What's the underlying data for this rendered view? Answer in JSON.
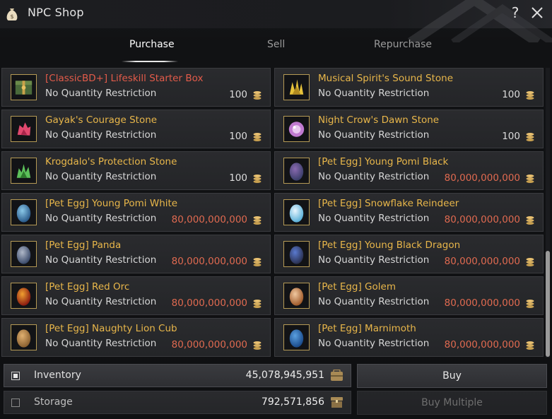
{
  "window": {
    "title": "NPC Shop"
  },
  "titlebar": {
    "help_glyph": "?"
  },
  "tabs": [
    {
      "label": "Purchase",
      "active": true
    },
    {
      "label": "Sell",
      "active": false
    },
    {
      "label": "Repurchase",
      "active": false
    }
  ],
  "items": [
    {
      "name": "[ClassicBD+] Lifeskill Starter Box",
      "restriction": "No Quantity Restriction",
      "price": "100",
      "name_color": "red",
      "icon": "starter-box-icon"
    },
    {
      "name": "Musical Spirit's Sound Stone",
      "restriction": "No Quantity Restriction",
      "price": "100",
      "name_color": "gold",
      "icon": "sound-stone-icon"
    },
    {
      "name": "Gayak's Courage Stone",
      "restriction": "No Quantity Restriction",
      "price": "100",
      "name_color": "gold",
      "icon": "courage-stone-icon"
    },
    {
      "name": "Night Crow's Dawn Stone",
      "restriction": "No Quantity Restriction",
      "price": "100",
      "name_color": "gold",
      "icon": "dawn-stone-icon"
    },
    {
      "name": "Krogdalo's Protection Stone",
      "restriction": "No Quantity Restriction",
      "price": "100",
      "name_color": "gold",
      "icon": "protection-stone-icon"
    },
    {
      "name": "[Pet Egg] Young Pomi Black",
      "restriction": "No Quantity Restriction",
      "price": "80,000,000,000",
      "name_color": "gold",
      "icon": "egg-pomi-black-icon"
    },
    {
      "name": "[Pet Egg] Young Pomi White",
      "restriction": "No Quantity Restriction",
      "price": "80,000,000,000",
      "name_color": "gold",
      "icon": "egg-pomi-white-icon"
    },
    {
      "name": "[Pet Egg] Snowflake Reindeer",
      "restriction": "No Quantity Restriction",
      "price": "80,000,000,000",
      "name_color": "gold",
      "icon": "egg-reindeer-icon"
    },
    {
      "name": "[Pet Egg] Panda",
      "restriction": "No Quantity Restriction",
      "price": "80,000,000,000",
      "name_color": "gold",
      "icon": "egg-panda-icon"
    },
    {
      "name": "[Pet Egg] Young Black Dragon",
      "restriction": "No Quantity Restriction",
      "price": "80,000,000,000",
      "name_color": "gold",
      "icon": "egg-black-dragon-icon"
    },
    {
      "name": "[Pet Egg] Red Orc",
      "restriction": "No Quantity Restriction",
      "price": "80,000,000,000",
      "name_color": "gold",
      "icon": "egg-red-orc-icon"
    },
    {
      "name": "[Pet Egg] Golem",
      "restriction": "No Quantity Restriction",
      "price": "80,000,000,000",
      "name_color": "gold",
      "icon": "egg-golem-icon"
    },
    {
      "name": "[Pet Egg] Naughty Lion Cub",
      "restriction": "No Quantity Restriction",
      "price": "80,000,000,000",
      "name_color": "gold",
      "icon": "egg-lion-cub-icon"
    },
    {
      "name": "[Pet Egg] Marnimoth",
      "restriction": "No Quantity Restriction",
      "price": "80,000,000,000",
      "name_color": "gold",
      "icon": "egg-marnimoth-icon"
    }
  ],
  "inventory": {
    "label": "Inventory",
    "amount": "45,078,945,951",
    "checked": true
  },
  "storage": {
    "label": "Storage",
    "amount": "792,571,856",
    "checked": false
  },
  "buttons": {
    "buy": "Buy",
    "buy_multiple": "Buy Multiple"
  },
  "colors": {
    "gold_text": "#e8b64a",
    "red_text": "#e35b4a",
    "price_red": "#e06a50",
    "icon_border": "#b59a55"
  }
}
